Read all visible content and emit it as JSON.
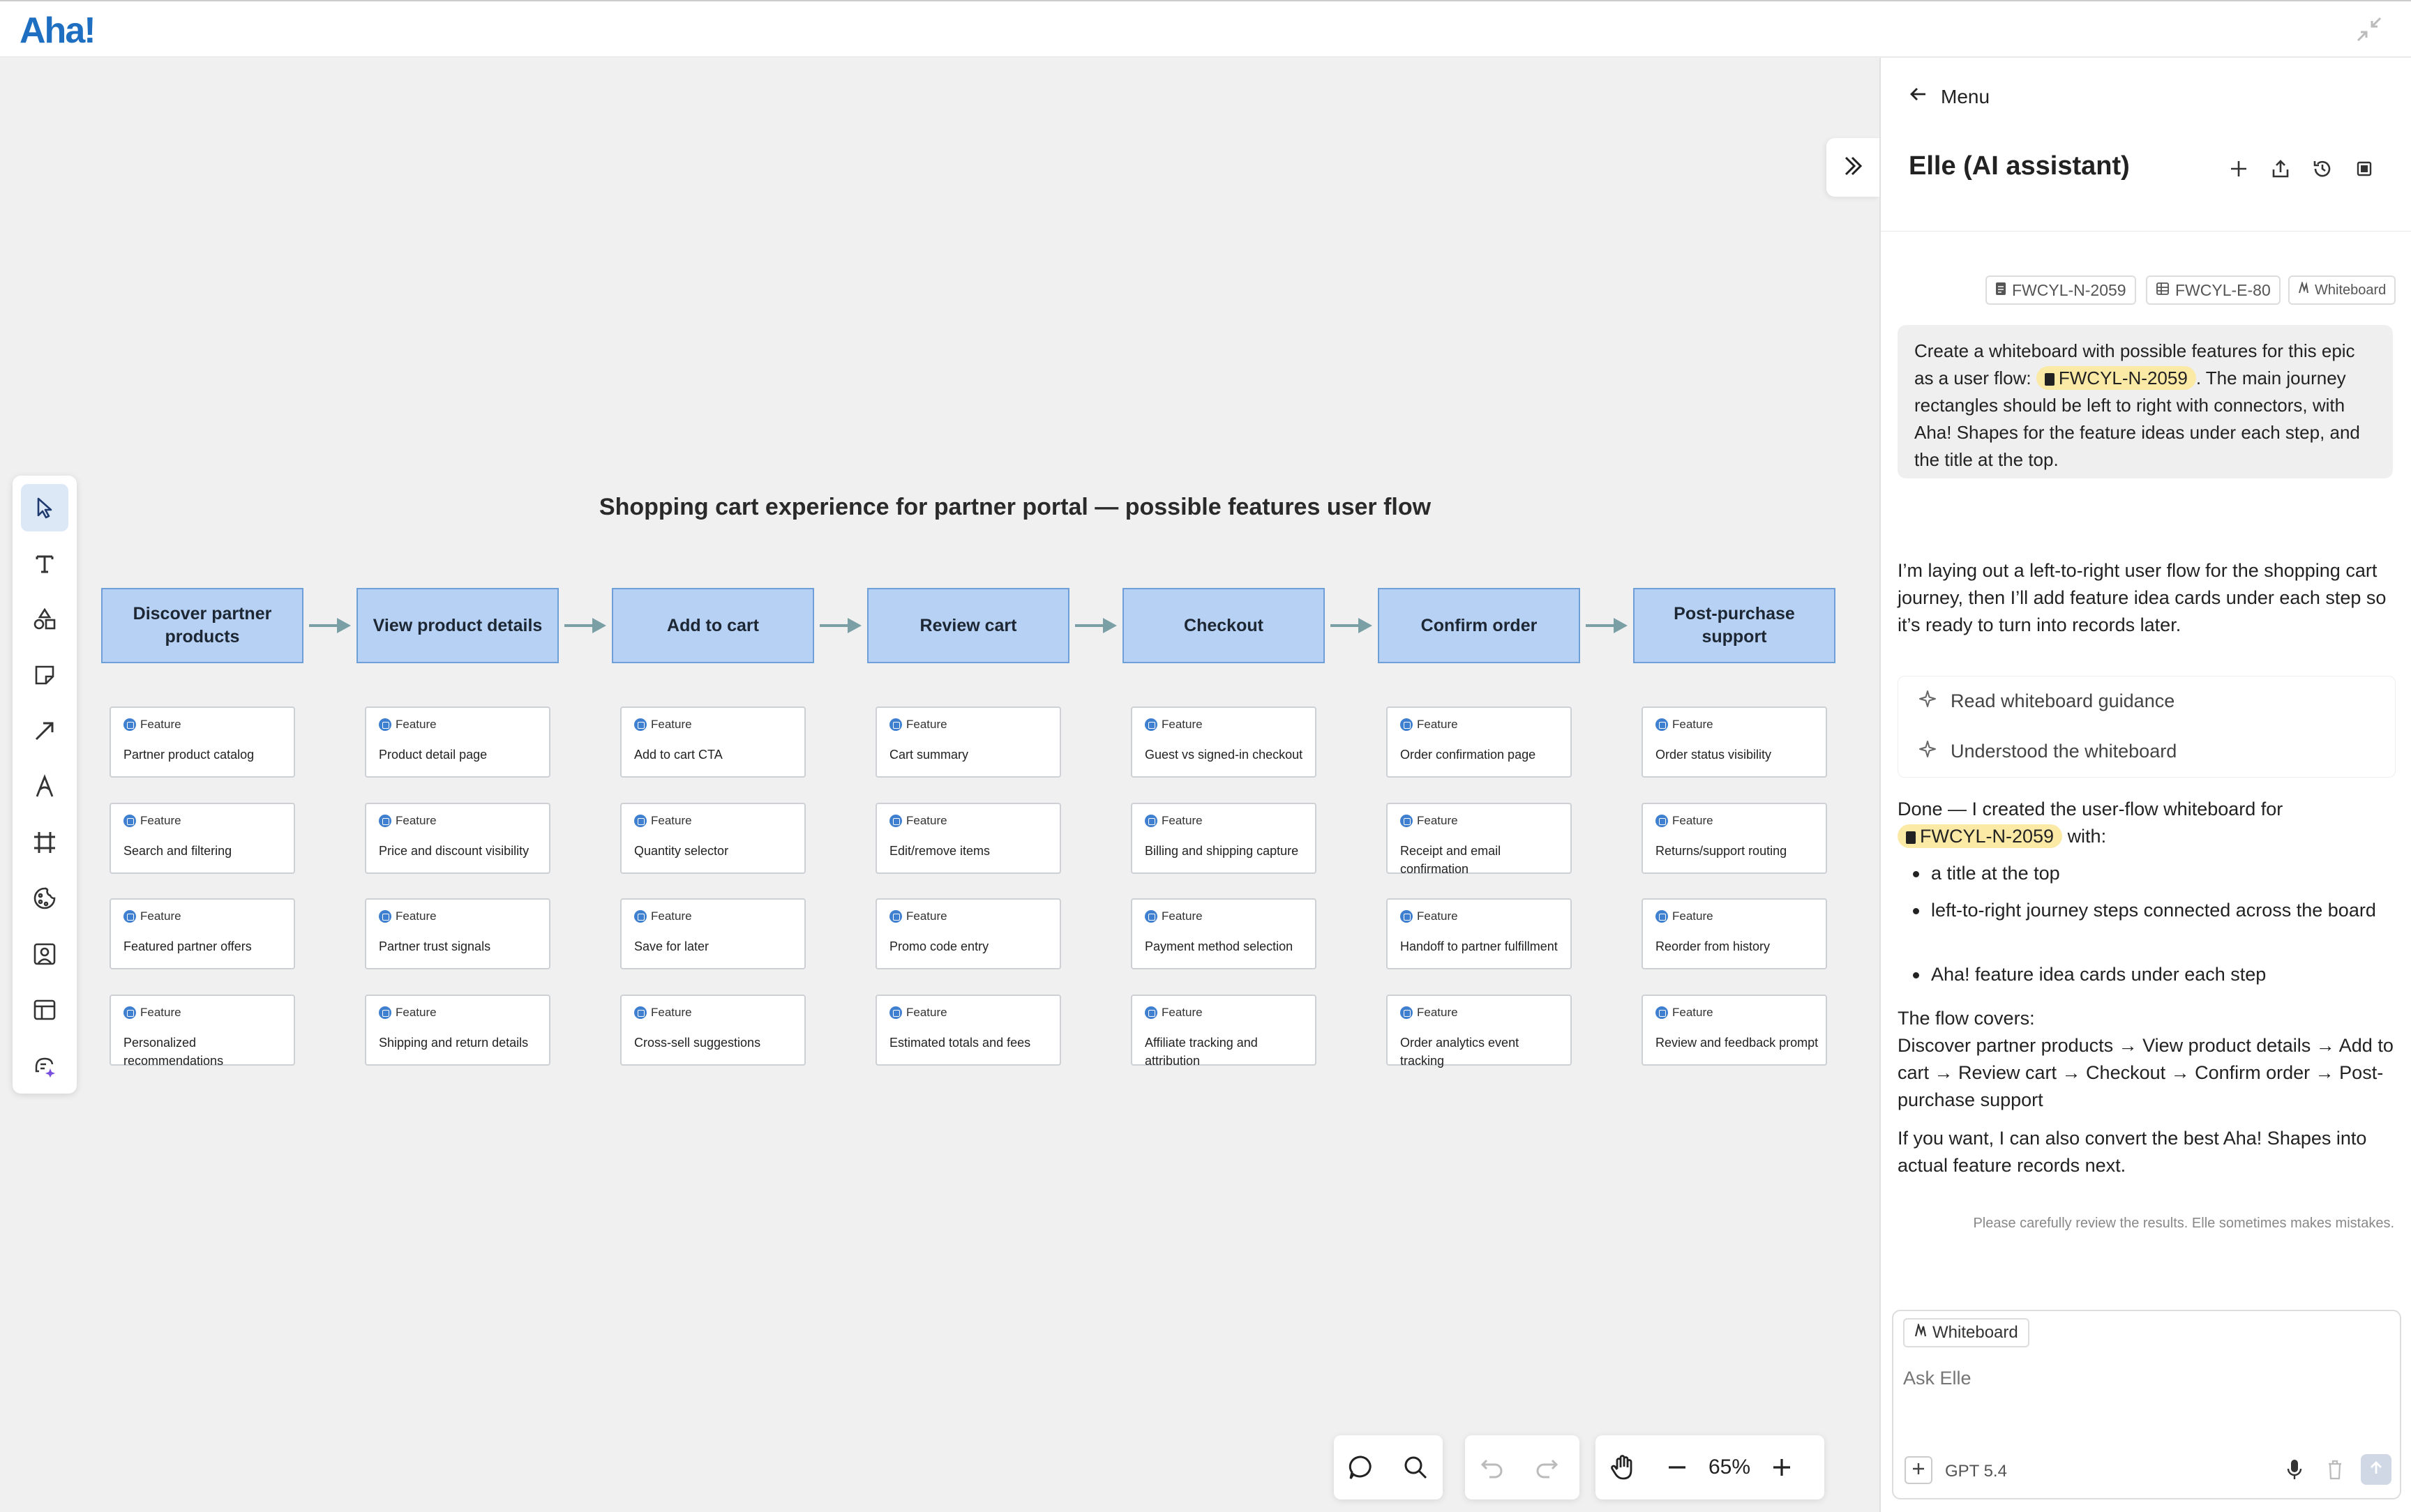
{
  "app": {
    "logo": "Aha!"
  },
  "whiteboard": {
    "title": "Shopping cart experience for partner portal — possible features user flow",
    "feature_label": "Feature",
    "steps": [
      {
        "label": "Discover partner products",
        "features": [
          "Partner product catalog",
          "Search and filtering",
          "Featured partner offers",
          "Personalized recommendations"
        ]
      },
      {
        "label": "View product details",
        "features": [
          "Product detail page",
          "Price and discount visibility",
          "Partner trust signals",
          "Shipping and return details"
        ]
      },
      {
        "label": "Add to cart",
        "features": [
          "Add to cart CTA",
          "Quantity selector",
          "Save for later",
          "Cross-sell suggestions"
        ]
      },
      {
        "label": "Review cart",
        "features": [
          "Cart summary",
          "Edit/remove items",
          "Promo code entry",
          "Estimated totals and fees"
        ]
      },
      {
        "label": "Checkout",
        "features": [
          "Guest vs signed-in checkout",
          "Billing and shipping capture",
          "Payment method selection",
          "Affiliate tracking and attribution"
        ]
      },
      {
        "label": "Confirm order",
        "features": [
          "Order confirmation page",
          "Receipt and email confirmation",
          "Handoff to partner fulfillment",
          "Order analytics event tracking"
        ]
      },
      {
        "label": "Post-purchase support",
        "features": [
          "Order status visibility",
          "Returns/support routing",
          "Reorder from history",
          "Review and feedback prompt"
        ]
      }
    ]
  },
  "toolbar": {
    "tools": [
      "select-tool",
      "text-tool",
      "shapes-tool",
      "sticky-note-tool",
      "connector-tool",
      "pen-tool",
      "frame-tool",
      "sticker-tool",
      "image-tool",
      "template-tool",
      "ai-tool"
    ]
  },
  "controls": {
    "zoom": "65%"
  },
  "panel": {
    "menu_label": "Menu",
    "title": "Elle (AI assistant)",
    "chips": [
      "FWCYL-N-2059",
      "FWCYL-E-80",
      "Whiteboard"
    ],
    "user_message": {
      "before": "Create a whiteboard with possible features for this epic as a user flow:",
      "ref": "FWCYL-N-2059",
      "after": ". The main journey rectangles should be left to right with connectors, with Aha! Shapes for the feature ideas under each step, and the title at the top."
    },
    "reply_intro": "I’m laying out a left-to-right user flow for the shopping cart journey, then I’ll add feature idea cards under each step so it’s ready to turn into records later.",
    "work_steps": [
      "Read whiteboard guidance",
      "Understood the whiteboard"
    ],
    "done_before": "Done — I created the user-flow whiteboard for",
    "done_ref": "FWCYL-N-2059",
    "done_after": "with:",
    "bullets": [
      "a title at the top",
      "left-to-right journey steps connected across the board",
      "Aha! feature idea cards under each step"
    ],
    "flow_heading": "The flow covers:",
    "flow_text": "Discover partner products → View product details → Add to cart → Review cart → Checkout → Confirm order → Post-purchase support",
    "offer": "If you want, I can also convert the best Aha! Shapes into actual feature records next.",
    "disclaimer": "Please carefully review the results. Elle sometimes makes mistakes.",
    "composer": {
      "context_chip": "Whiteboard",
      "placeholder": "Ask Elle",
      "model": "GPT 5.4"
    }
  }
}
